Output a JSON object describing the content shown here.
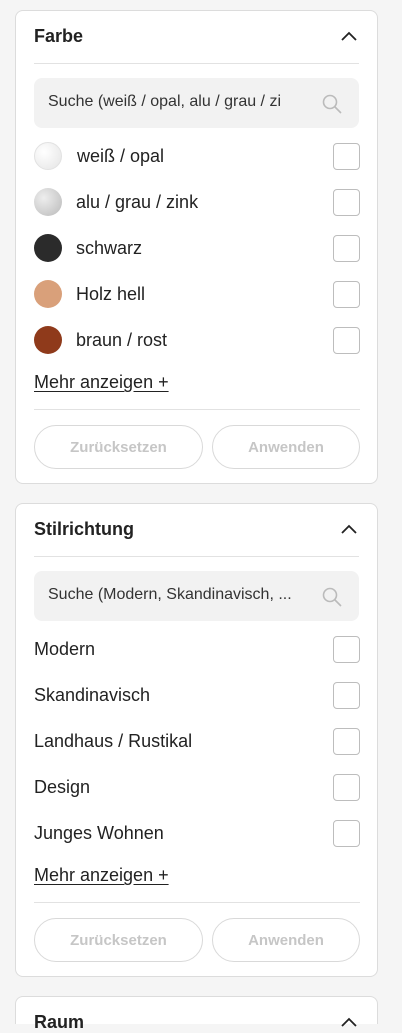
{
  "filters": [
    {
      "title": "Farbe",
      "search_placeholder": "Suche (weiß / opal, alu / grau / zi",
      "options": [
        {
          "label": "weiß / opal",
          "color": "#eeeeee"
        },
        {
          "label": "alu / grau / zink",
          "color": "#cfcfcf"
        },
        {
          "label": "schwarz",
          "color": "#2b2b2b"
        },
        {
          "label": "Holz hell",
          "color": "#d9a07a"
        },
        {
          "label": "braun / rost",
          "color": "#8f3a1b"
        }
      ],
      "more_label": "Mehr anzeigen +",
      "reset_label": "Zurücksetzen",
      "apply_label": "Anwenden"
    },
    {
      "title": "Stilrichtung",
      "search_placeholder": "Suche (Modern, Skandinavisch, ...",
      "options": [
        {
          "label": "Modern"
        },
        {
          "label": "Skandinavisch"
        },
        {
          "label": "Landhaus / Rustikal"
        },
        {
          "label": "Design"
        },
        {
          "label": "Junges Wohnen"
        }
      ],
      "more_label": "Mehr anzeigen +",
      "reset_label": "Zurücksetzen",
      "apply_label": "Anwenden"
    },
    {
      "title": "Raum"
    }
  ]
}
